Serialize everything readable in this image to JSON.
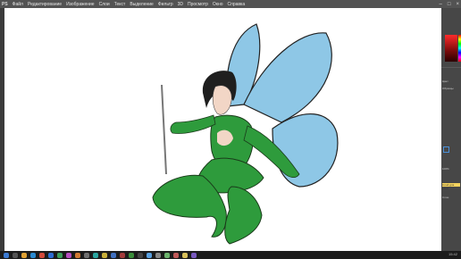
{
  "app": {
    "logo": "PS"
  },
  "menu": [
    "Файл",
    "Редактирование",
    "Изображение",
    "Слои",
    "Текст",
    "Выделение",
    "Фильтр",
    "3D",
    "Просмотр",
    "Окно",
    "Справка"
  ],
  "window_controls": [
    "–",
    "□",
    "×"
  ],
  "panel": {
    "zoom": "100%",
    "tag": "Слой для слоя",
    "labels": [
      "Цвет",
      "Образцы",
      "Слои"
    ]
  },
  "taskbar": {
    "icons": [
      "start-icon",
      "search-icon",
      "explorer-icon",
      "browser-icon",
      "chrome-icon",
      "photoshop-icon",
      "mail-icon",
      "music-icon",
      "photos-icon",
      "settings-icon",
      "store-icon",
      "files-icon",
      "paint-icon",
      "video-icon",
      "chat-icon",
      "terminal-icon",
      "cloud-icon",
      "calc-icon",
      "map-icon",
      "news-icon",
      "weather-icon",
      "game-icon"
    ],
    "clock": "15:42"
  },
  "colors": {
    "wing": "#8ec7e6",
    "dress": "#2e9b3c",
    "skin": "#f2d6c6",
    "hair": "#1f1f1f"
  }
}
